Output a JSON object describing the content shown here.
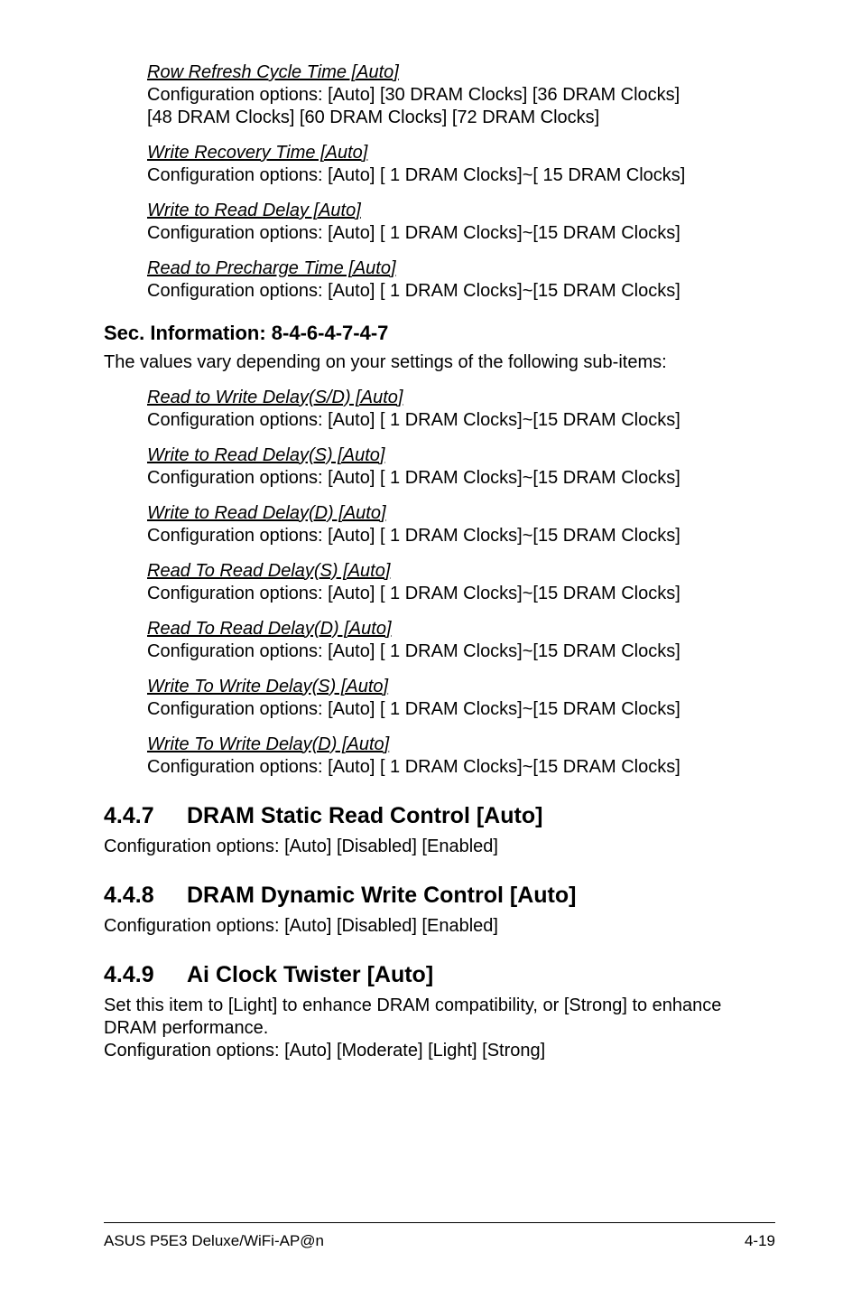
{
  "subs1": [
    {
      "title": "Row Refresh Cycle Time [Auto]",
      "body1": "Configuration options: [Auto] [30 DRAM Clocks] [36 DRAM Clocks]",
      "body2": "[48 DRAM Clocks] [60 DRAM Clocks] [72 DRAM Clocks]"
    },
    {
      "title": "Write Recovery Time [Auto]",
      "body1": "Configuration options: [Auto] [ 1 DRAM Clocks]~[ 15 DRAM Clocks]"
    },
    {
      "title": "Write to Read Delay [Auto]",
      "body1": "Configuration options: [Auto] [ 1 DRAM Clocks]~[15 DRAM Clocks]"
    },
    {
      "title": "Read to Precharge Time [Auto]",
      "body1": "Configuration options: [Auto] [ 1 DRAM Clocks]~[15 DRAM Clocks]"
    }
  ],
  "sec_info_heading": "Sec. Information: 8-4-6-4-7-4-7",
  "sec_info_para": "The values vary depending on your settings of the following sub-items:",
  "subs2": [
    {
      "title": "Read to Write Delay(S/D) [Auto]",
      "body1": "Configuration options: [Auto] [ 1 DRAM Clocks]~[15 DRAM Clocks]"
    },
    {
      "title": "Write to Read Delay(S) [Auto]",
      "body1": "Configuration options: [Auto] [ 1 DRAM Clocks]~[15 DRAM Clocks]"
    },
    {
      "title": "Write to Read Delay(D) [Auto]",
      "body1": "Configuration options: [Auto] [ 1 DRAM Clocks]~[15 DRAM Clocks]"
    },
    {
      "title": "Read To Read Delay(S) [Auto]",
      "body1": "Configuration options: [Auto] [ 1 DRAM Clocks]~[15 DRAM Clocks]"
    },
    {
      "title": "Read To Read Delay(D) [Auto]",
      "body1": "Configuration options: [Auto] [ 1 DRAM Clocks]~[15 DRAM Clocks]"
    },
    {
      "title": "Write To Write Delay(S) [Auto]",
      "body1": "Configuration options: [Auto] [ 1 DRAM Clocks]~[15 DRAM Clocks]"
    },
    {
      "title": "Write To Write Delay(D) [Auto]",
      "body1": "Configuration options: [Auto] [ 1 DRAM Clocks]~[15 DRAM Clocks]"
    }
  ],
  "sections": [
    {
      "num": "4.4.7",
      "title": "DRAM Static Read Control [Auto]",
      "body": "Configuration options: [Auto] [Disabled] [Enabled]"
    },
    {
      "num": "4.4.8",
      "title": "DRAM Dynamic Write Control [Auto]",
      "body": "Configuration options: [Auto] [Disabled] [Enabled]"
    },
    {
      "num": "4.4.9",
      "title": "Ai Clock Twister [Auto]",
      "body1": "Set this item to [Light] to enhance DRAM compatibility, or [Strong] to enhance DRAM performance.",
      "body2": "Configuration options: [Auto] [Moderate] [Light] [Strong]"
    }
  ],
  "footer": {
    "left": "ASUS P5E3 Deluxe/WiFi-AP@n",
    "right": "4-19"
  }
}
